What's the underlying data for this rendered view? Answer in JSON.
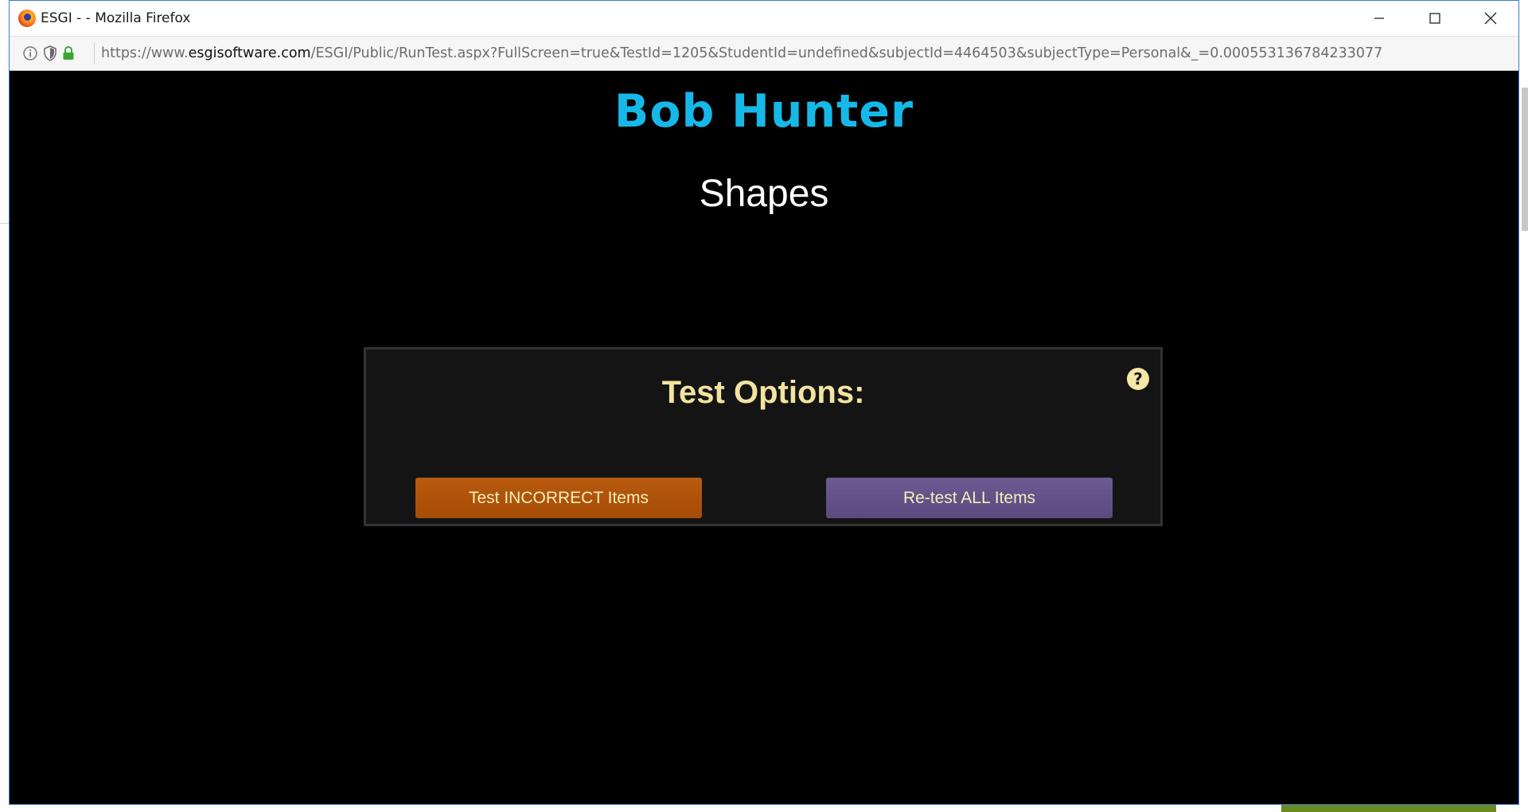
{
  "window": {
    "title": "ESGI - - Mozilla Firefox",
    "controls": {
      "minimize": "minimize-icon",
      "maximize": "maximize-icon",
      "close": "close-icon"
    }
  },
  "urlbar": {
    "prefix": "https://www.",
    "domain": "esgisoftware.com",
    "path": "/ESGI/Public/RunTest.aspx?FullScreen=true&TestId=1205&StudentId=undefined&subjectId=4464503&subjectType=Personal&_=0.000553136784233077",
    "icons": [
      "info-icon",
      "shield-icon",
      "lock-icon"
    ]
  },
  "test": {
    "student_name": "Bob Hunter",
    "test_name": "Shapes",
    "options_title": "Test Options:",
    "help_symbol": "?",
    "btn_incorrect": "Test INCORRECT Items",
    "btn_retest": "Re-test ALL Items"
  },
  "colors": {
    "student_name": "#16b8e8",
    "options_title": "#f2e4a0",
    "btn_incorrect": "#a54c06",
    "btn_retest": "#5b4980",
    "lock": "#3ca635"
  }
}
